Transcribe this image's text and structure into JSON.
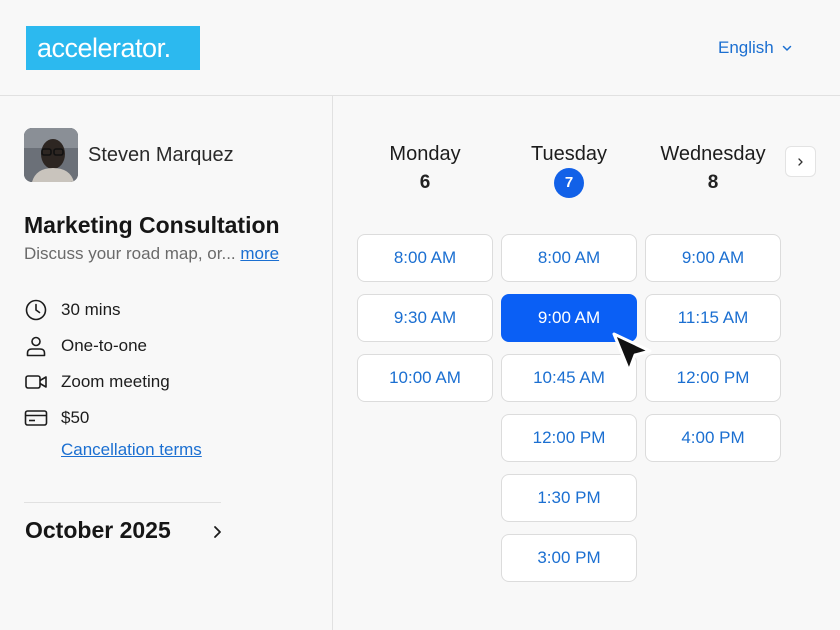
{
  "header": {
    "logo_text": "accelerator.",
    "language": "English"
  },
  "host": {
    "name": "Steven Marquez"
  },
  "event": {
    "title": "Marketing Consultation",
    "description": "Discuss your road map, or...",
    "more_label": "more",
    "details": {
      "duration": "30 mins",
      "type": "One-to-one",
      "location": "Zoom meeting",
      "price": "$50"
    },
    "cancellation_label": "Cancellation terms"
  },
  "calendar": {
    "month_label": "October 2025",
    "days": [
      {
        "name": "Monday",
        "number": "6",
        "today": false
      },
      {
        "name": "Tuesday",
        "number": "7",
        "today": true
      },
      {
        "name": "Wednesday",
        "number": "8",
        "today": false
      }
    ],
    "slots": {
      "monday": [
        "8:00 AM",
        "9:30 AM",
        "10:00 AM"
      ],
      "tuesday": [
        "8:00 AM",
        "9:00 AM",
        "10:45 AM",
        "12:00 PM",
        "1:30 PM",
        "3:00 PM"
      ],
      "wednesday": [
        "9:00 AM",
        "11:15 AM",
        "12:00 PM",
        "4:00 PM"
      ]
    },
    "selected_slot": "Tuesday 9:00 AM"
  },
  "colors": {
    "brand": "#2cb9ef",
    "accent": "#0a5ff5",
    "link": "#1b6fd1"
  },
  "icons": [
    "clock-icon",
    "person-icon",
    "video-icon",
    "credit-card-icon",
    "chevron-right-icon",
    "chevron-down-icon",
    "mouse-pointer-icon"
  ]
}
